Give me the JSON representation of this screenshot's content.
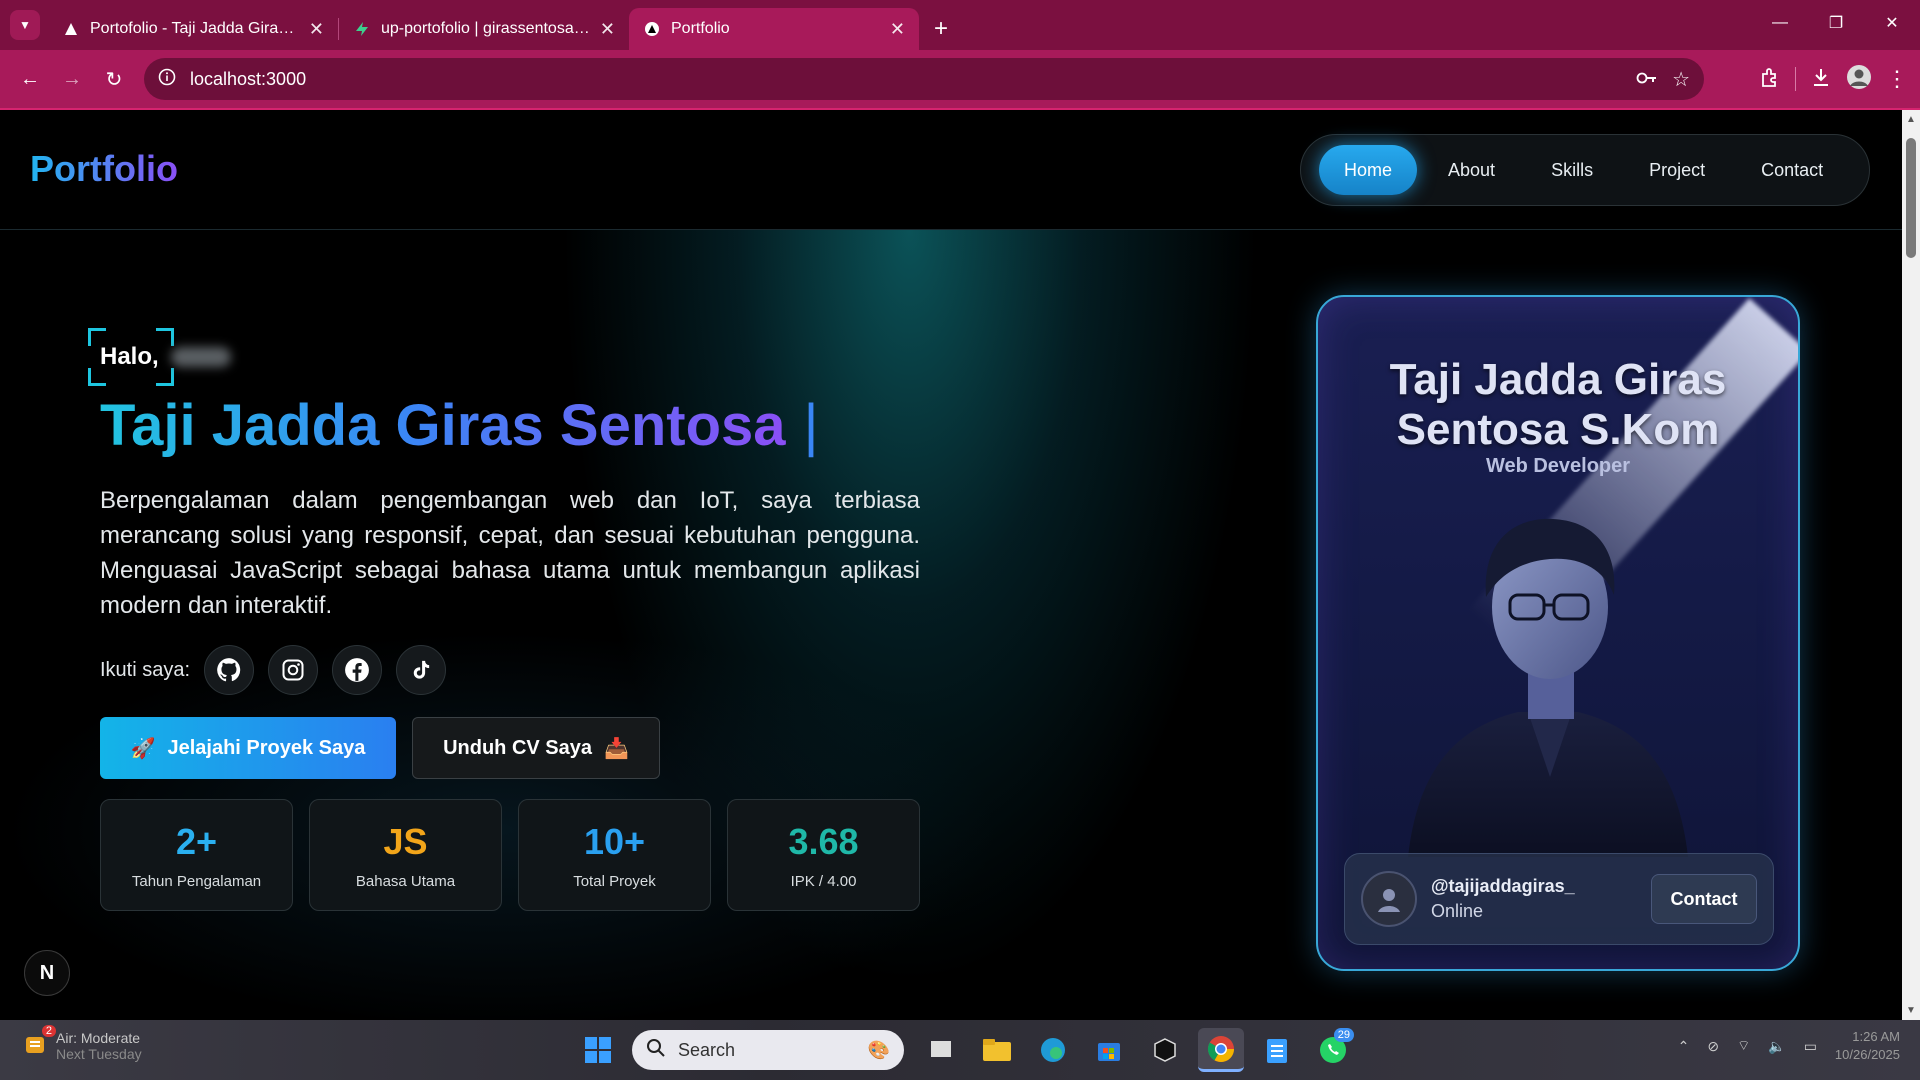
{
  "browser": {
    "tabs": [
      {
        "title": "Portofolio - Taji Jadda Giras Sentosa",
        "active": false
      },
      {
        "title": "up-portofolio | girassentosa's Overview",
        "active": false
      },
      {
        "title": "Portfolio",
        "active": true
      }
    ],
    "url": "localhost:3000"
  },
  "nav": {
    "logo": "Portfolio",
    "items": [
      "Home",
      "About",
      "Skills",
      "Project",
      "Contact"
    ],
    "active": "Home"
  },
  "hero": {
    "greeting": "Halo,",
    "name": "Taji Jadda Giras Sentosa",
    "cursor": "|",
    "description": "Berpengalaman dalam pengembangan web dan IoT, saya terbiasa merancang solusi yang responsif, cepat, dan sesuai kebutuhan pengguna. Menguasai JavaScript sebagai bahasa utama untuk membangun aplikasi modern dan interaktif.",
    "follow_label": "Ikuti saya:",
    "socials": [
      "github-icon",
      "instagram-icon",
      "facebook-icon",
      "tiktok-icon"
    ],
    "primary_button": "Jelajahi Proyek Saya",
    "secondary_button": "Unduh CV Saya",
    "stats": [
      {
        "value": "2+",
        "label": "Tahun Pengalaman",
        "color": "#2ab0f0"
      },
      {
        "value": "JS",
        "label": "Bahasa Utama",
        "color": "#f2a51a"
      },
      {
        "value": "10+",
        "label": "Total Proyek",
        "color": "#2aa0f0"
      },
      {
        "value": "3.68",
        "label": "IPK / 4.00",
        "color": "#1fb8a8"
      }
    ]
  },
  "card": {
    "name": "Taji Jadda Giras Sentosa S.Kom",
    "role": "Web Developer",
    "handle": "@tajijaddagiras_",
    "status": "Online",
    "contact_button": "Contact"
  },
  "next_badge": "N",
  "taskbar": {
    "weather_badge": "2",
    "weather_line1": "Air: Moderate",
    "weather_line2": "Next Tuesday",
    "search_placeholder": "Search",
    "whatsapp_badge": "29",
    "time": "1:26 AM",
    "date": "10/26/2025"
  },
  "colors": {
    "tabbar": "#7b1040",
    "toolbar": "#a81a5a",
    "accent": "#27a9ee"
  }
}
